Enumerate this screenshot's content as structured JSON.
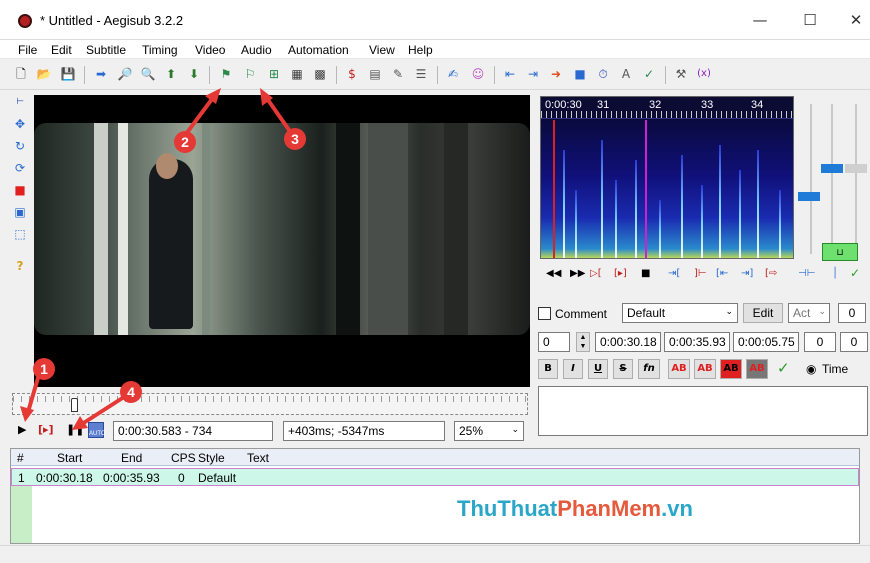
{
  "window": {
    "title": "* Untitled - Aegisub 3.2.2",
    "minimize": "—",
    "maximize": "☐",
    "close": "✕"
  },
  "menu": [
    "File",
    "Edit",
    "Subtitle",
    "Timing",
    "Video",
    "Audio",
    "Automation",
    "View",
    "Help"
  ],
  "toolbar": {
    "icons": [
      "new-file",
      "open-file",
      "save-file",
      "jump-to",
      "zoom",
      "zoom-in",
      "attach",
      "export",
      "subtitle-style",
      "subtitle-style-2",
      "chain",
      "film",
      "film-2",
      "dollar",
      "properties",
      "spell",
      "list",
      "automation",
      "avatar",
      "lead-in",
      "lead-out",
      "keyframe",
      "stop",
      "timing",
      "fonts",
      "styling",
      "tools",
      "variable"
    ]
  },
  "left_tools": [
    "ruler",
    "move",
    "rotate",
    "rotate-xy",
    "scale",
    "clip",
    "vector-clip",
    "help"
  ],
  "video": {
    "time": "0:00:30.583 - 734",
    "offset": "+403ms; -5347ms",
    "zoom": "25%"
  },
  "audio": {
    "ruler_labels": [
      "0:00:30",
      "31",
      "32",
      "33",
      "34"
    ]
  },
  "edit": {
    "comment_label": "Comment",
    "style": "Default",
    "edit_button": "Edit",
    "actor": "Act",
    "margin": "0",
    "layer": "0",
    "start": "0:00:30.18",
    "end": "0:00:35.93",
    "duration": "0:00:05.75",
    "margin_l": "0",
    "margin_r": "0",
    "time_label": "Time",
    "format_buttons": [
      "B",
      "I",
      "U",
      "S",
      "fn",
      "AB",
      "AB",
      "AB",
      "AB"
    ]
  },
  "grid": {
    "headers": [
      "#",
      "Start",
      "End",
      "CPS",
      "Style",
      "Text"
    ],
    "rows": [
      {
        "n": "1",
        "start": "0:00:30.18",
        "end": "0:00:35.93",
        "cps": "0",
        "style": "Default",
        "text": ""
      }
    ]
  },
  "annotations": [
    "1",
    "2",
    "3",
    "4"
  ],
  "watermark": {
    "part1": "ThuThuat",
    "part2": "PhanMem",
    "part3": ".vn"
  }
}
